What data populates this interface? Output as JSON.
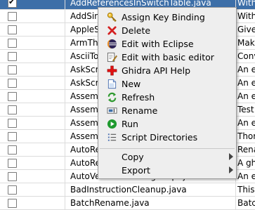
{
  "table": {
    "rows": [
      {
        "checked": true,
        "selected": true,
        "name": "AddReferencesInSwitchTable.java",
        "desc": "With"
      },
      {
        "checked": false,
        "selected": false,
        "name": "AddSingleReferenceInSwitchTable.java",
        "desc": "With"
      },
      {
        "checked": false,
        "selected": false,
        "name": "AppleSingleDoubleScript.java",
        "desc": "Give"
      },
      {
        "checked": false,
        "selected": false,
        "name": "ArmThumbFunctionTableScript.java",
        "desc": "Make"
      },
      {
        "checked": false,
        "selected": false,
        "name": "AsciiToBinaryScript.java",
        "desc": "Conv"
      },
      {
        "checked": false,
        "selected": false,
        "name": "AskScriptPy.py",
        "desc": "An e"
      },
      {
        "checked": false,
        "selected": false,
        "name": "AskScript.java",
        "desc": "An e"
      },
      {
        "checked": false,
        "selected": false,
        "name": "AssemblyThrasherDevScript.java",
        "desc": "An e"
      },
      {
        "checked": false,
        "selected": false,
        "name": "AssembleBlockScript.java",
        "desc": "Test"
      },
      {
        "checked": false,
        "selected": false,
        "name": "AssembleCheckDevScript.java",
        "desc": "An e"
      },
      {
        "checked": false,
        "selected": false,
        "name": "AssembleScript.java",
        "desc": "Thor"
      },
      {
        "checked": false,
        "selected": false,
        "name": "AutoRenameLabelsScript.java",
        "desc": "Rena"
      },
      {
        "checked": false,
        "selected": false,
        "name": "AutoRenameSimpleLabels.java",
        "desc": "A gh"
      },
      {
        "checked": false,
        "selected": false,
        "name": "AutoVersionTrackingScript.java",
        "desc": "An e"
      },
      {
        "checked": false,
        "selected": false,
        "name": "BadInstructionCleanup.java",
        "desc": "This"
      },
      {
        "checked": false,
        "selected": false,
        "name": "BatchRename.java",
        "desc": "Batc"
      }
    ]
  },
  "context_menu": {
    "items": [
      {
        "id": "assign-key-binding",
        "label": "Assign Key Binding",
        "icon": "key-icon"
      },
      {
        "id": "delete",
        "label": "Delete",
        "icon": "delete-icon"
      },
      {
        "id": "edit-with-eclipse",
        "label": "Edit with Eclipse",
        "icon": "eclipse-icon"
      },
      {
        "id": "edit-with-basic-editor",
        "label": "Edit with basic editor",
        "icon": "edit-icon"
      },
      {
        "id": "ghidra-api-help",
        "label": "Ghidra API Help",
        "icon": "help-cross-icon"
      },
      {
        "id": "new",
        "label": "New",
        "icon": "new-file-icon"
      },
      {
        "id": "refresh",
        "label": "Refresh",
        "icon": "refresh-icon"
      },
      {
        "id": "rename",
        "label": "Rename",
        "icon": "rename-icon"
      },
      {
        "id": "run",
        "label": "Run",
        "icon": "run-icon"
      },
      {
        "id": "script-directories",
        "label": "Script Directories",
        "icon": "list-icon"
      },
      {
        "id": "copy",
        "label": "Copy",
        "submenu": true
      },
      {
        "id": "export",
        "label": "Export",
        "submenu": true
      }
    ]
  },
  "colors": {
    "selection": "#3d6fa8",
    "menu_bg": "#eeeeee"
  }
}
